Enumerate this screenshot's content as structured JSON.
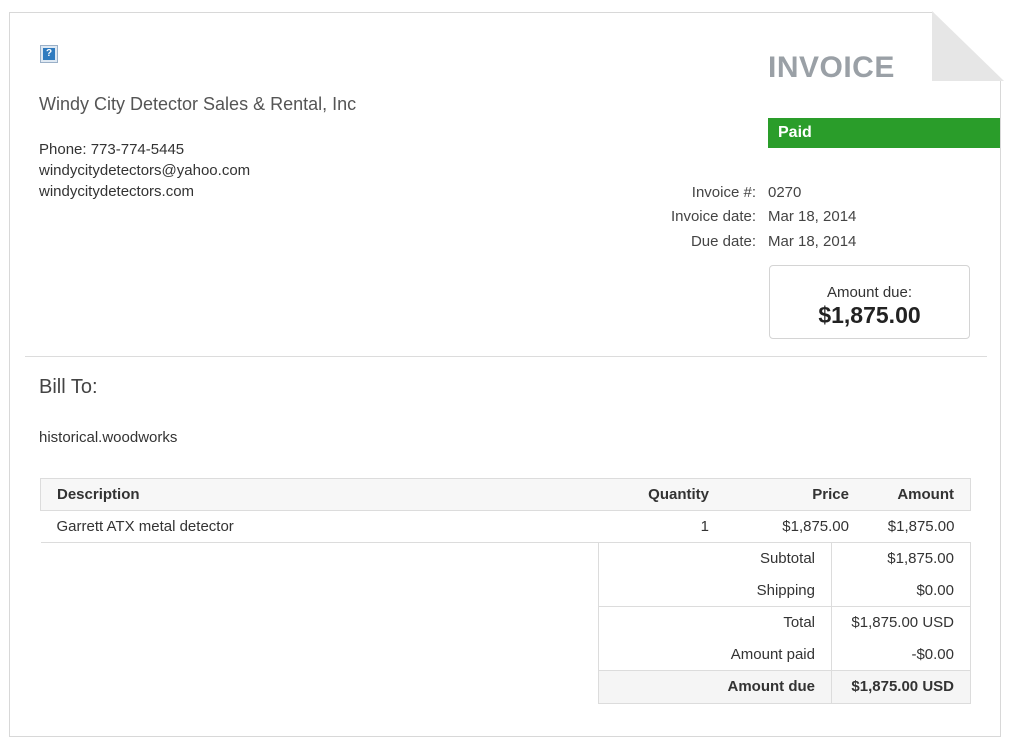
{
  "company": {
    "name": "Windy City Detector Sales & Rental, Inc",
    "phone": "Phone: 773-774-5445",
    "email": "windycitydetectors@yahoo.com",
    "website": "windycitydetectors.com",
    "logo_icon": "broken-image-icon"
  },
  "invoice": {
    "title": "INVOICE",
    "status": "Paid",
    "status_color": "#2a9d2a",
    "number_label": "Invoice #:",
    "number": "0270",
    "date_label": "Invoice date:",
    "date": "Mar 18, 2014",
    "due_label": "Due date:",
    "due": "Mar 18, 2014",
    "amount_due_label": "Amount due:",
    "amount_due": "$1,875.00"
  },
  "bill_to": {
    "heading": "Bill To:",
    "name": "historical.woodworks"
  },
  "items": {
    "headers": [
      "Description",
      "Quantity",
      "Price",
      "Amount"
    ],
    "rows": [
      [
        "Garrett ATX metal detector",
        "1",
        "$1,875.00",
        "$1,875.00"
      ]
    ]
  },
  "totals": [
    {
      "label": "Subtotal",
      "value": "$1,875.00"
    },
    {
      "label": "Shipping",
      "value": "$0.00"
    },
    {
      "label": "Total",
      "value": "$1,875.00 USD"
    },
    {
      "label": "Amount paid",
      "value": "-$0.00"
    },
    {
      "label": "Amount due",
      "value": "$1,875.00 USD"
    }
  ]
}
